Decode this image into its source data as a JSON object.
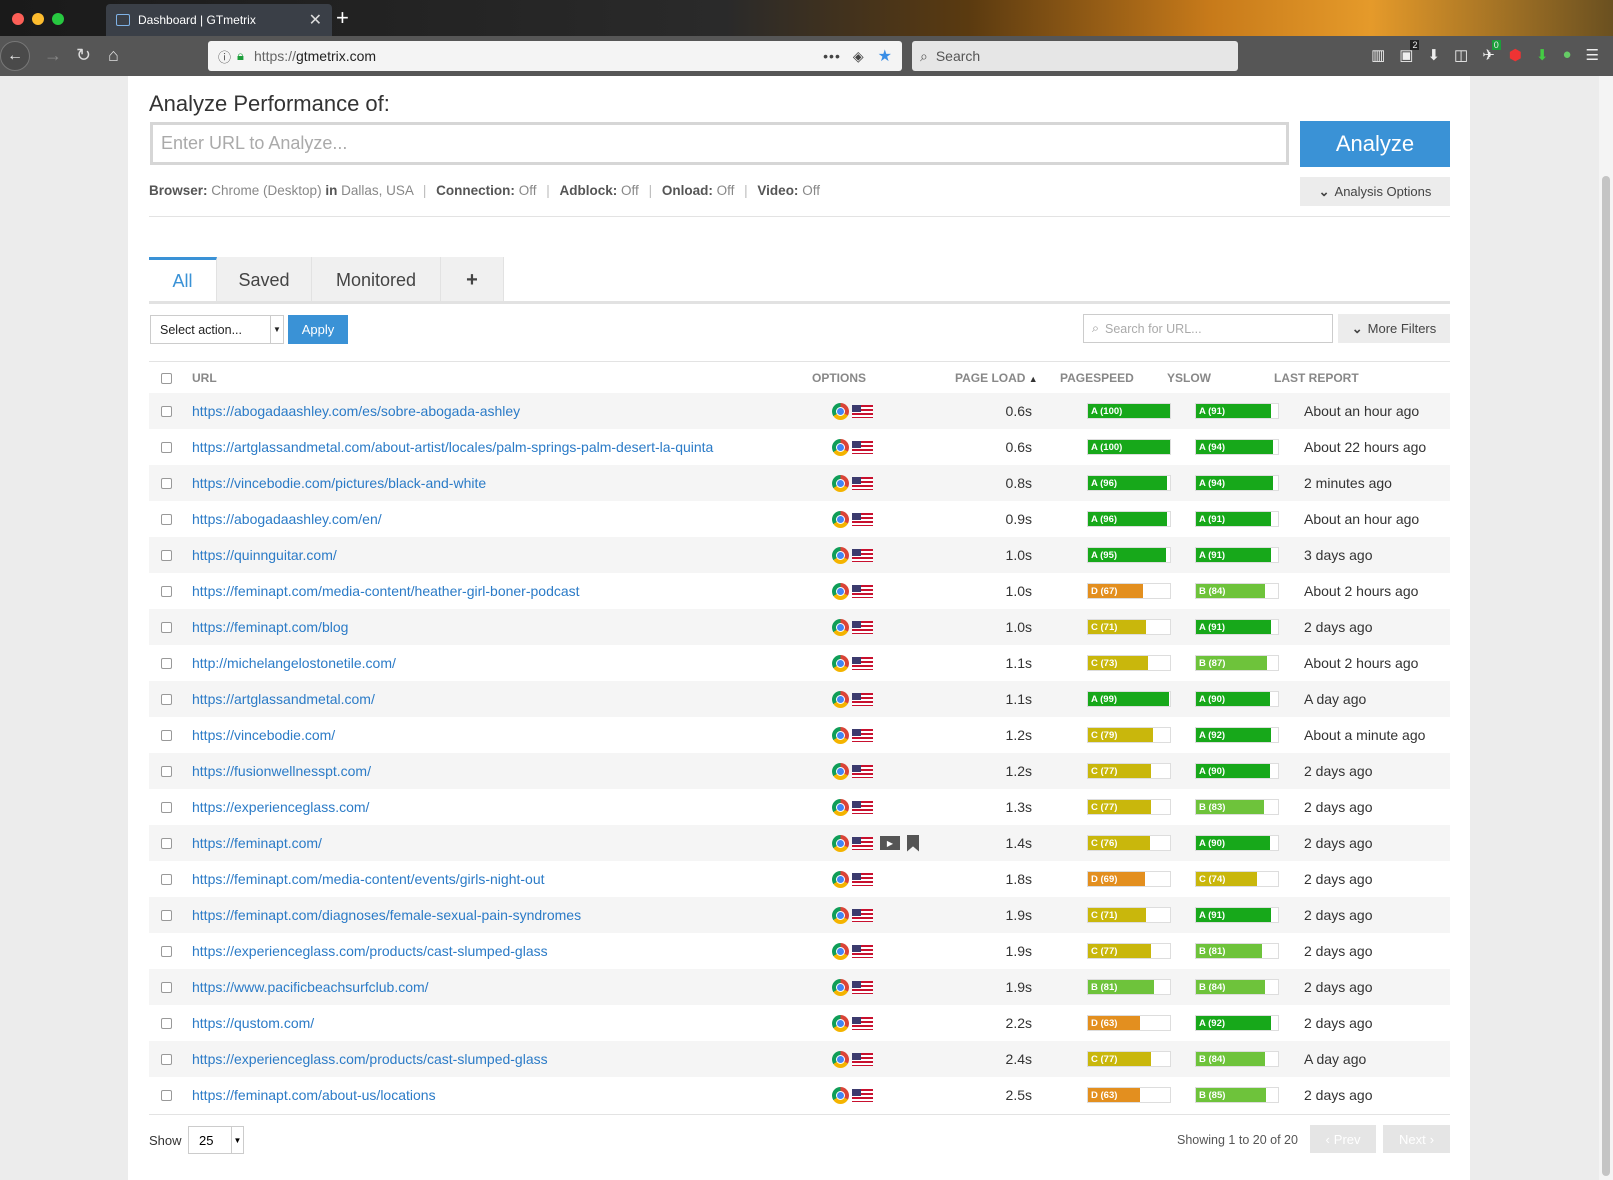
{
  "browser": {
    "tab_title": "Dashboard | GTmetrix",
    "url_prefix": "https://",
    "url_host": "gtmetrix.com",
    "search_placeholder": "Search",
    "downloads_badge": "2",
    "ext_badge": "0"
  },
  "analyze": {
    "title": "Analyze Performance of:",
    "placeholder": "Enter URL to Analyze...",
    "button": "Analyze",
    "options_button": "Analysis Options",
    "settings": {
      "browser_label": "Browser:",
      "browser_value": "Chrome (Desktop)",
      "in_label": "in",
      "location_value": "Dallas, USA",
      "connection_label": "Connection:",
      "connection_value": "Off",
      "adblock_label": "Adblock:",
      "adblock_value": "Off",
      "onload_label": "Onload:",
      "onload_value": "Off",
      "video_label": "Video:",
      "video_value": "Off"
    }
  },
  "tabs": [
    "All",
    "Saved",
    "Monitored",
    "+"
  ],
  "toolbar": {
    "select_action": "Select action...",
    "apply": "Apply",
    "search_placeholder": "Search for URL...",
    "more_filters": "More Filters"
  },
  "table": {
    "headers": {
      "url": "URL",
      "options": "OPTIONS",
      "page_load": "PAGE LOAD",
      "pagespeed": "PAGESPEED",
      "yslow": "YSLOW",
      "last_report": "LAST REPORT"
    },
    "rows": [
      {
        "url": "https://abogadaashley.com/es/sobre-abogada-ashley",
        "load": "0.6s",
        "ps": "A (100)",
        "ps_score": 100,
        "ys": "A (91)",
        "ys_score": 91,
        "last": "About an hour ago"
      },
      {
        "url": "https://artglassandmetal.com/about-artist/locales/palm-springs-palm-desert-la-quinta",
        "load": "0.6s",
        "ps": "A (100)",
        "ps_score": 100,
        "ys": "A (94)",
        "ys_score": 94,
        "last": "About 22 hours ago"
      },
      {
        "url": "https://vincebodie.com/pictures/black-and-white",
        "load": "0.8s",
        "ps": "A (96)",
        "ps_score": 96,
        "ys": "A (94)",
        "ys_score": 94,
        "last": "2 minutes ago"
      },
      {
        "url": "https://abogadaashley.com/en/",
        "load": "0.9s",
        "ps": "A (96)",
        "ps_score": 96,
        "ys": "A (91)",
        "ys_score": 91,
        "last": "About an hour ago"
      },
      {
        "url": "https://quinnguitar.com/",
        "load": "1.0s",
        "ps": "A (95)",
        "ps_score": 95,
        "ys": "A (91)",
        "ys_score": 91,
        "last": "3 days ago"
      },
      {
        "url": "https://feminapt.com/media-content/heather-girl-boner-podcast",
        "load": "1.0s",
        "ps": "D (67)",
        "ps_score": 67,
        "ys": "B (84)",
        "ys_score": 84,
        "last": "About 2 hours ago"
      },
      {
        "url": "https://feminapt.com/blog",
        "load": "1.0s",
        "ps": "C (71)",
        "ps_score": 71,
        "ys": "A (91)",
        "ys_score": 91,
        "last": "2 days ago"
      },
      {
        "url": "http://michelangelostonetile.com/",
        "load": "1.1s",
        "ps": "C (73)",
        "ps_score": 73,
        "ys": "B (87)",
        "ys_score": 87,
        "last": "About 2 hours ago"
      },
      {
        "url": "https://artglassandmetal.com/",
        "load": "1.1s",
        "ps": "A (99)",
        "ps_score": 99,
        "ys": "A (90)",
        "ys_score": 90,
        "last": "A day ago"
      },
      {
        "url": "https://vincebodie.com/",
        "load": "1.2s",
        "ps": "C (79)",
        "ps_score": 79,
        "ys": "A (92)",
        "ys_score": 92,
        "last": "About a minute ago"
      },
      {
        "url": "https://fusionwellnesspt.com/",
        "load": "1.2s",
        "ps": "C (77)",
        "ps_score": 77,
        "ys": "A (90)",
        "ys_score": 90,
        "last": "2 days ago"
      },
      {
        "url": "https://experienceglass.com/",
        "load": "1.3s",
        "ps": "C (77)",
        "ps_score": 77,
        "ys": "B (83)",
        "ys_score": 83,
        "last": "2 days ago"
      },
      {
        "url": "https://feminapt.com/",
        "load": "1.4s",
        "ps": "C (76)",
        "ps_score": 76,
        "ys": "A (90)",
        "ys_score": 90,
        "last": "2 days ago",
        "extra_icons": true
      },
      {
        "url": "https://feminapt.com/media-content/events/girls-night-out",
        "load": "1.8s",
        "ps": "D (69)",
        "ps_score": 69,
        "ys": "C (74)",
        "ys_score": 74,
        "last": "2 days ago"
      },
      {
        "url": "https://feminapt.com/diagnoses/female-sexual-pain-syndromes",
        "load": "1.9s",
        "ps": "C (71)",
        "ps_score": 71,
        "ys": "A (91)",
        "ys_score": 91,
        "last": "2 days ago"
      },
      {
        "url": "https://experienceglass.com/products/cast-slumped-glass",
        "load": "1.9s",
        "ps": "C (77)",
        "ps_score": 77,
        "ys": "B (81)",
        "ys_score": 81,
        "last": "2 days ago"
      },
      {
        "url": "https://www.pacificbeachsurfclub.com/",
        "load": "1.9s",
        "ps": "B (81)",
        "ps_score": 81,
        "ys": "B (84)",
        "ys_score": 84,
        "last": "2 days ago"
      },
      {
        "url": "https://qustom.com/",
        "load": "2.2s",
        "ps": "D (63)",
        "ps_score": 63,
        "ys": "A (92)",
        "ys_score": 92,
        "last": "2 days ago"
      },
      {
        "url": "https://experienceglass.com/products/cast-slumped-glass",
        "load": "2.4s",
        "ps": "C (77)",
        "ps_score": 77,
        "ys": "B (84)",
        "ys_score": 84,
        "last": "A day ago"
      },
      {
        "url": "https://feminapt.com/about-us/locations",
        "load": "2.5s",
        "ps": "D (63)",
        "ps_score": 63,
        "ys": "B (85)",
        "ys_score": 85,
        "last": "2 days ago"
      }
    ]
  },
  "grade_colors": {
    "A": "#17a81a",
    "B": "#6ec33b",
    "C": "#c9b70c",
    "D": "#e38f1f"
  },
  "footer": {
    "show_label": "Show",
    "show_value": "25",
    "showing": "Showing 1 to 20 of 20",
    "prev": "Prev",
    "next": "Next"
  }
}
